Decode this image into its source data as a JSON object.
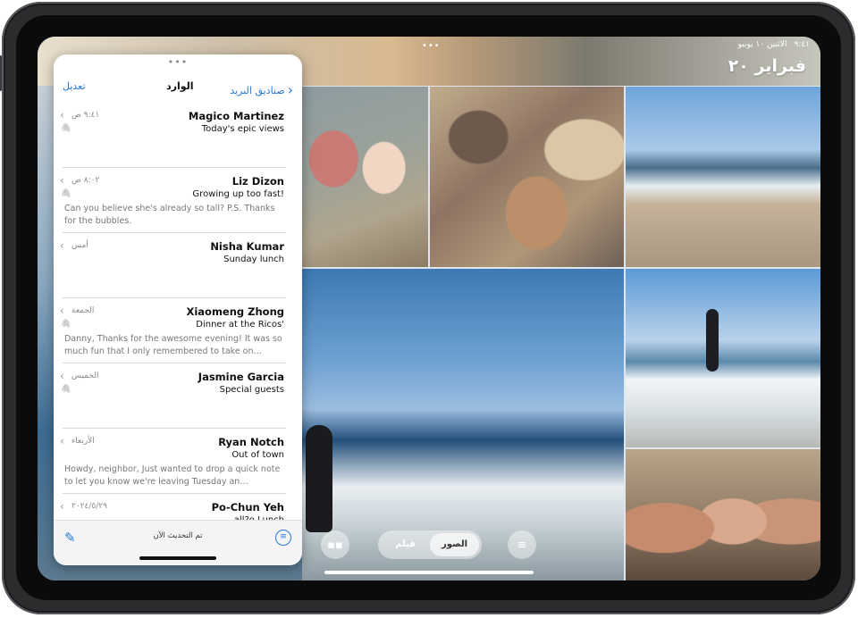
{
  "photos": {
    "status_time": "٩:٤١",
    "status_date": "الاثنين ١٠ يونيو",
    "title": "فبراير ٢٠",
    "tabs": [
      {
        "label": "الصور",
        "active": true
      },
      {
        "label": "فيلم",
        "active": false
      }
    ],
    "icons": {
      "filter": "filter-icon",
      "grid": "grid-icon"
    }
  },
  "mail": {
    "nav": {
      "edit": "تعديل",
      "title": "الوارد",
      "back": "صناديق البريد"
    },
    "messages": [
      {
        "sender": "Magico Martinez",
        "subject": "Today's epic views",
        "preview": "",
        "time": "٩:٤١ ص",
        "attachment": true
      },
      {
        "sender": "Liz Dizon",
        "subject": "Growing up too fast!",
        "preview": "Can you believe she's already so tall? P.S. Thanks for the bubbles.",
        "time": "٨:٠٢ ص",
        "attachment": true
      },
      {
        "sender": "Nisha Kumar",
        "subject": "Sunday lunch",
        "preview": "",
        "time": "أمس",
        "attachment": false
      },
      {
        "sender": "Xiaomeng Zhong",
        "subject": "Dinner at the Ricos'",
        "preview": "Danny, Thanks for the awesome evening! It was so much fun that I only remembered to take on…",
        "time": "الجمعة",
        "attachment": true
      },
      {
        "sender": "Jasmine Garcia",
        "subject": "Special guests",
        "preview": "",
        "time": "الخميس",
        "attachment": true
      },
      {
        "sender": "Ryan Notch",
        "subject": "Out of town",
        "preview": "Howdy, neighbor, Just wanted to drop a quick note to let you know we're leaving Tuesday an…",
        "time": "الأربعاء",
        "attachment": false
      },
      {
        "sender": "Po-Chun Yeh",
        "subject": "all?o Lunch",
        "preview": "",
        "time": "٢٠٢٤/٥/٢٩",
        "attachment": false
      }
    ],
    "toolbar": {
      "updated": "تم التحديث الآن"
    }
  }
}
